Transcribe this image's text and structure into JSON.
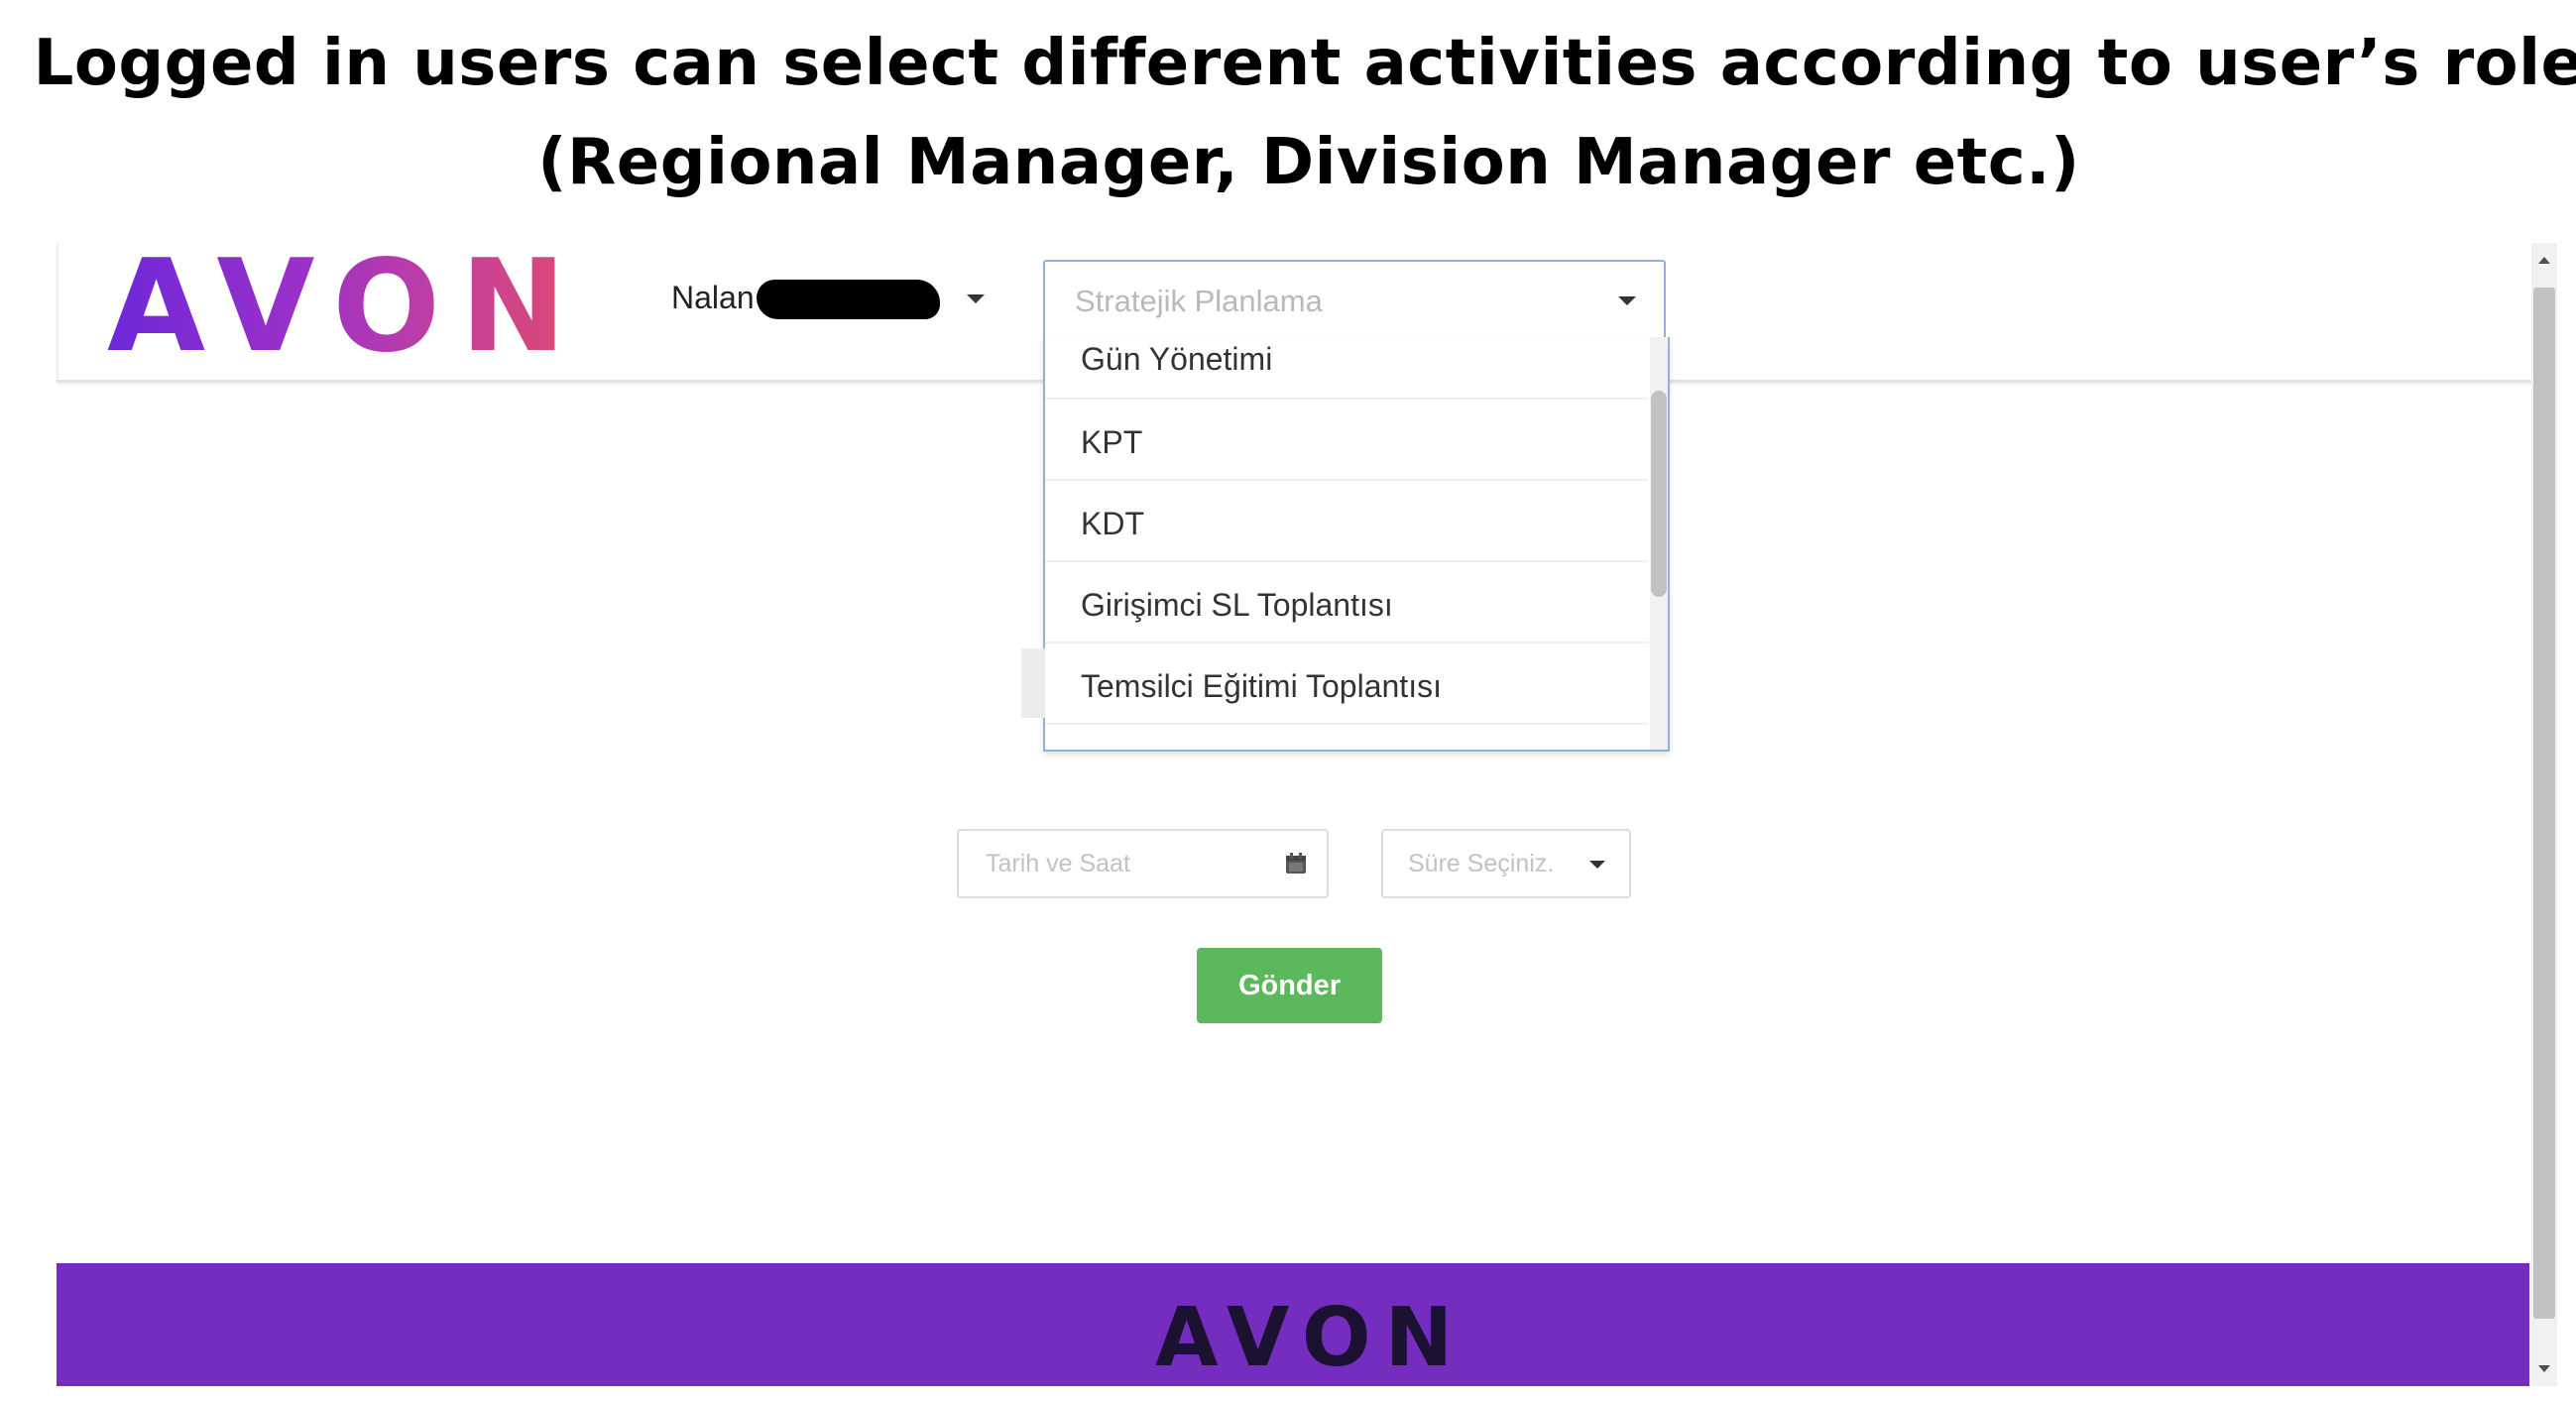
{
  "caption": {
    "line1": "Logged in users can select different activities according to user’s role",
    "line2": "(Regional Manager, Division Manager etc.)"
  },
  "header": {
    "logo": "AVON",
    "user_name": "Nalan B",
    "activity_select": {
      "placeholder": "Stratejik Planlama",
      "options": [
        "Gün Yönetimi",
        "KPT",
        "KDT",
        "Girişimci SL Toplantısı",
        "Temsilci Eğitimi Toplantısı"
      ]
    }
  },
  "form": {
    "date_placeholder": "Tarih ve Saat",
    "duration_placeholder": "Süre Seçiniz.",
    "submit_label": "Gönder"
  },
  "footer": {
    "logo": "AVON"
  },
  "colors": {
    "accent_purple": "#742dbf",
    "button_green": "#5cb85c",
    "focus_border": "#8fb2dd"
  }
}
